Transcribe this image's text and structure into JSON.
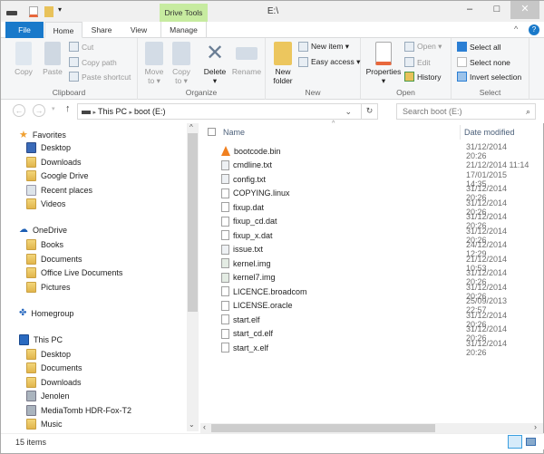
{
  "window": {
    "title": "E:\\",
    "context_tab": "Drive Tools",
    "controls": [
      "–",
      "□",
      "✕"
    ]
  },
  "tabs": [
    "File",
    "Home",
    "Share",
    "View",
    "Manage"
  ],
  "ribbon": {
    "clipboard": {
      "label": "Clipboard",
      "copy": "Copy",
      "paste": "Paste",
      "cut": "Cut",
      "copy_path": "Copy path",
      "paste_shortcut": "Paste shortcut"
    },
    "organize": {
      "label": "Organize",
      "move_to": [
        "Move",
        "to ▾"
      ],
      "copy_to": [
        "Copy",
        "to ▾"
      ],
      "delete": "Delete",
      "rename": "Rename"
    },
    "new": {
      "label": "New",
      "new_folder": [
        "New",
        "folder"
      ],
      "new_item": "New item ▾",
      "easy_access": "Easy access ▾"
    },
    "open": {
      "label": "Open",
      "properties": "Properties",
      "open": "Open ▾",
      "edit": "Edit",
      "history": "History"
    },
    "select": {
      "label": "Select",
      "select_all": "Select all",
      "select_none": "Select none",
      "invert": "Invert selection"
    }
  },
  "address": {
    "path": [
      "This PC",
      "boot (E:)"
    ],
    "search_placeholder": "Search boot (E:)"
  },
  "nav": {
    "favorites": {
      "label": "Favorites",
      "items": [
        "Desktop",
        "Downloads",
        "Google Drive",
        "Recent places",
        "Videos"
      ]
    },
    "onedrive": {
      "label": "OneDrive",
      "items": [
        "Books",
        "Documents",
        "Office Live Documents",
        "Pictures"
      ]
    },
    "homegroup": "Homegroup",
    "thispc": {
      "label": "This PC",
      "items": [
        "Desktop",
        "Documents",
        "Downloads",
        "Jenolen",
        "MediaTomb HDR-Fox-T2",
        "Music"
      ]
    }
  },
  "columns": {
    "name": "Name",
    "date": "Date modified"
  },
  "files": [
    {
      "name": "bootcode.bin",
      "date": "31/12/2014 20:26",
      "icon": "vlc-icon"
    },
    {
      "name": "cmdline.txt",
      "date": "21/12/2014 11:14",
      "icon": "text-file-icon"
    },
    {
      "name": "config.txt",
      "date": "17/01/2015 14:35",
      "icon": "text-file-icon"
    },
    {
      "name": "COPYING.linux",
      "date": "31/12/2014 20:26",
      "icon": "file-icon"
    },
    {
      "name": "fixup.dat",
      "date": "31/12/2014 20:26",
      "icon": "file-icon"
    },
    {
      "name": "fixup_cd.dat",
      "date": "31/12/2014 20:26",
      "icon": "file-icon"
    },
    {
      "name": "fixup_x.dat",
      "date": "31/12/2014 20:26",
      "icon": "file-icon"
    },
    {
      "name": "issue.txt",
      "date": "24/12/2014 12:29",
      "icon": "text-file-icon"
    },
    {
      "name": "kernel.img",
      "date": "21/12/2014 10:53",
      "icon": "image-file-icon"
    },
    {
      "name": "kernel7.img",
      "date": "31/12/2014 20:26",
      "icon": "image-file-icon"
    },
    {
      "name": "LICENCE.broadcom",
      "date": "31/12/2014 20:26",
      "icon": "file-icon"
    },
    {
      "name": "LICENSE.oracle",
      "date": "25/09/2013 22:57",
      "icon": "file-icon"
    },
    {
      "name": "start.elf",
      "date": "31/12/2014 20:26",
      "icon": "file-icon"
    },
    {
      "name": "start_cd.elf",
      "date": "31/12/2014 20:26",
      "icon": "file-icon"
    },
    {
      "name": "start_x.elf",
      "date": "31/12/2014 20:26",
      "icon": "file-icon"
    }
  ],
  "status": {
    "count": "15 items"
  },
  "colors": {
    "file_tab": "#1979ca",
    "drive_tools": "#c7eba0",
    "accent": "#26a0da"
  }
}
